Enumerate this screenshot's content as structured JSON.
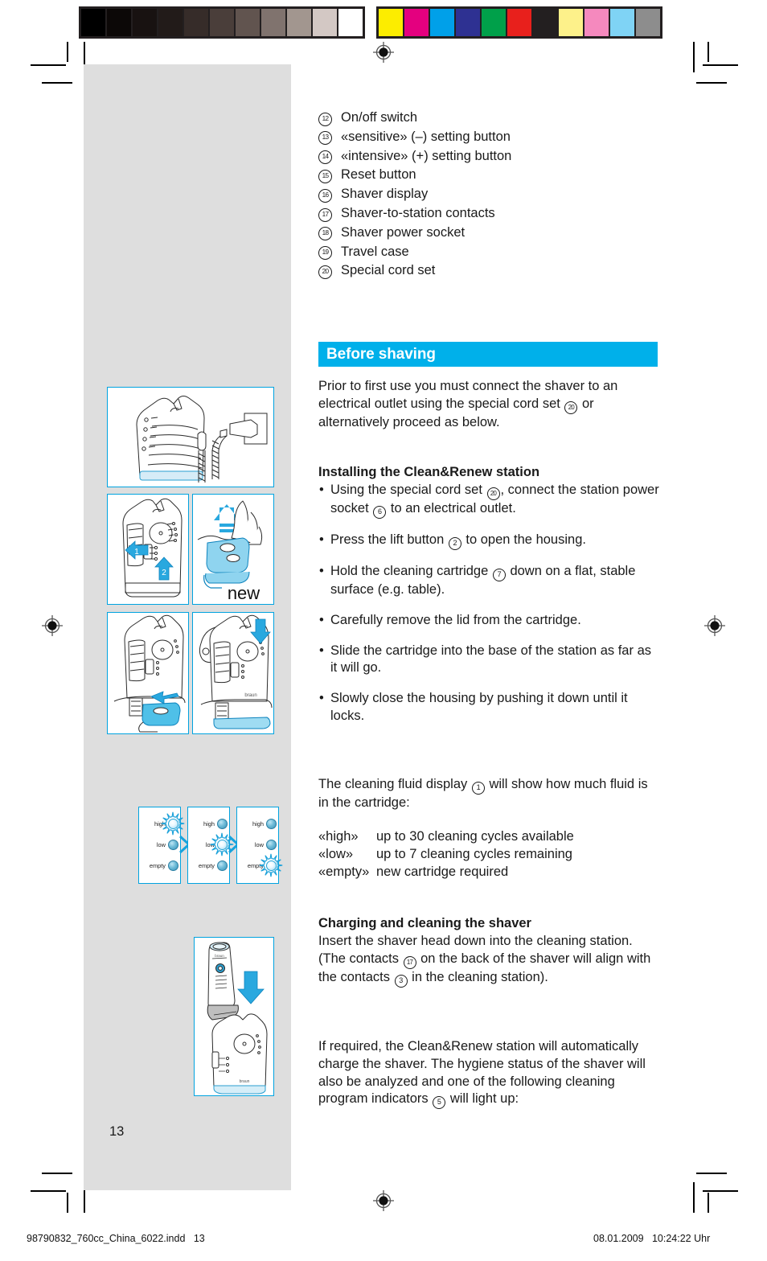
{
  "colorbar": {
    "grayscale": [
      "#000000",
      "#0c0807",
      "#181211",
      "#221b19",
      "#362c29",
      "#4a3e3a",
      "#61544f",
      "#80736e",
      "#a2968f",
      "#d3c8c4",
      "#ffffff"
    ],
    "colors": [
      "#fced00",
      "#e4007f",
      "#00a0e9",
      "#2e3192",
      "#00a04a",
      "#e8201c",
      "#231f20",
      "#fdf18a",
      "#f589be",
      "#7fd3f5",
      "#8d8d8d"
    ]
  },
  "parts": [
    {
      "num": "12",
      "label": "On/off switch"
    },
    {
      "num": "13",
      "label": "«sensitive» (–) setting button"
    },
    {
      "num": "14",
      "label": "«intensive» (+) setting button"
    },
    {
      "num": "15",
      "label": "Reset button"
    },
    {
      "num": "16",
      "label": "Shaver display"
    },
    {
      "num": "17",
      "label": "Shaver-to-station contacts"
    },
    {
      "num": "18",
      "label": "Shaver power socket"
    },
    {
      "num": "19",
      "label": "Travel case"
    },
    {
      "num": "20",
      "label": "Special cord set"
    }
  ],
  "section": {
    "banner_title": "Before shaving",
    "banner_color": "#00b0ea",
    "intro_a": "Prior to first use you must connect the shaver to an electrical outlet using the special cord set ",
    "intro_ref": "20",
    "intro_b": " or alternatively proceed as below."
  },
  "installing": {
    "heading": "Installing the Clean&Renew station",
    "steps": [
      {
        "a": "Using the special cord set ",
        "r1": "20",
        "b": ", connect the station power socket ",
        "r2": "6",
        "c": " to an electrical outlet."
      },
      {
        "a": "Press the lift button ",
        "r1": "2",
        "b": " to open the housing.",
        "r2": "",
        "c": ""
      },
      {
        "a": "Hold the cleaning cartridge ",
        "r1": "7",
        "b": " down on a flat, stable surface (e.g. table).",
        "r2": "",
        "c": ""
      },
      {
        "a": "Carefully remove the lid from the cartridge.",
        "r1": "",
        "b": "",
        "r2": "",
        "c": ""
      },
      {
        "a": "Slide the cartridge into the base of the station as far as it will go.",
        "r1": "",
        "b": "",
        "r2": "",
        "c": ""
      },
      {
        "a": "Slowly close the housing by pushing it down until it locks.",
        "r1": "",
        "b": "",
        "r2": "",
        "c": ""
      }
    ]
  },
  "fluid": {
    "intro_a": "The cleaning fluid display ",
    "intro_ref": "1",
    "intro_b": " will show how much fluid is in the cartridge:",
    "rows": [
      {
        "key": "«high»",
        "value": "up to 30 cleaning cycles available"
      },
      {
        "key": "«low»",
        "value": "up to 7 cleaning cycles remaining"
      },
      {
        "key": "«empty»",
        "value": "new cartridge required"
      }
    ]
  },
  "charging": {
    "heading": "Charging and cleaning the shaver",
    "p1_a": "Insert the shaver head down into the cleaning station. (The contacts ",
    "p1_r1": "17",
    "p1_b": " on the back of the shaver will align with the contacts ",
    "p1_r2": "3",
    "p1_c": " in the cleaning station).",
    "p2_a": "If required, the Clean&Renew station will automatically charge the shaver. The hygiene status of the shaver will also be analyzed and one of the following cleaning program indicators ",
    "p2_r1": "5",
    "p2_b": " will light up:"
  },
  "illustrations": {
    "cartridge_new_label": "new",
    "step_markers": [
      "1",
      "2"
    ],
    "brand_mark": "braun",
    "indicator_panels": [
      {
        "labels": [
          "high",
          "low",
          "empty"
        ],
        "lit": "high"
      },
      {
        "labels": [
          "high",
          "low",
          "empty"
        ],
        "lit": "low"
      },
      {
        "labels": [
          "high",
          "low",
          "empty"
        ],
        "lit": "empty"
      }
    ]
  },
  "page_number": "13",
  "footer": {
    "left": "98790832_760cc_China_6022.indd   13",
    "right": "08.01.2009   10:24:22 Uhr"
  }
}
